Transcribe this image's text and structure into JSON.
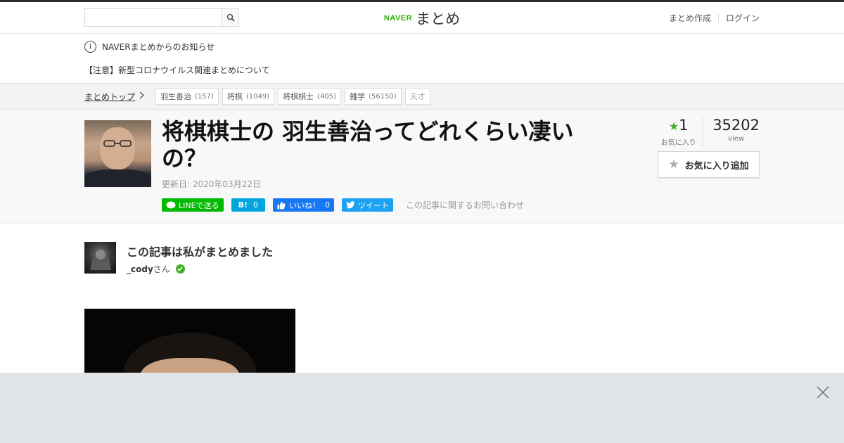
{
  "header": {
    "search_placeholder": "",
    "logo_brand": "NAVER",
    "logo_name": "まとめ",
    "nav": [
      "まとめ作成",
      "ログイン"
    ]
  },
  "notice": {
    "heading": "NAVERまとめからのお知らせ",
    "item": "【注意】新型コロナウイルス関連まとめについて"
  },
  "breadcrumb": {
    "top": "まとめトップ",
    "tags": [
      {
        "label": "羽生善治",
        "count": "(157)"
      },
      {
        "label": "将棋",
        "count": "(1049)"
      },
      {
        "label": "将棋棋士",
        "count": "(405)"
      },
      {
        "label": "雑学",
        "count": "(56150)"
      },
      {
        "label": "天才",
        "count": ""
      }
    ]
  },
  "article": {
    "title": "将棋棋士の 羽生善治ってどれくらい凄いの？",
    "updated": "更新日: 2020年03月22日",
    "share": {
      "line": "LINEで送る",
      "hatena_icon": "B!",
      "hatena_count": "0",
      "facebook": "いいね！",
      "facebook_count": "0",
      "tweet": "ツイート"
    },
    "inquiry": "この記事に関するお問い合わせ",
    "favorites": {
      "count": "1",
      "label": "お気に入り"
    },
    "views": {
      "count": "35202",
      "label": "view"
    },
    "fav_button": "お気に入り追加"
  },
  "author": {
    "heading": "この記事は私がまとめました",
    "name": "_cody",
    "suffix": "さん"
  },
  "colors": {
    "naver_green": "#2db400",
    "line_green": "#00b900",
    "hatena_blue": "#00a4de",
    "facebook_blue": "#1877f2",
    "twitter_blue": "#1da1f2",
    "star_green": "#43b02a"
  },
  "icons": {
    "search": "search-icon",
    "info": "info-icon",
    "chevron": "chevron-right-icon",
    "star": "star-icon",
    "check": "verified-check-icon",
    "close": "close-icon"
  }
}
